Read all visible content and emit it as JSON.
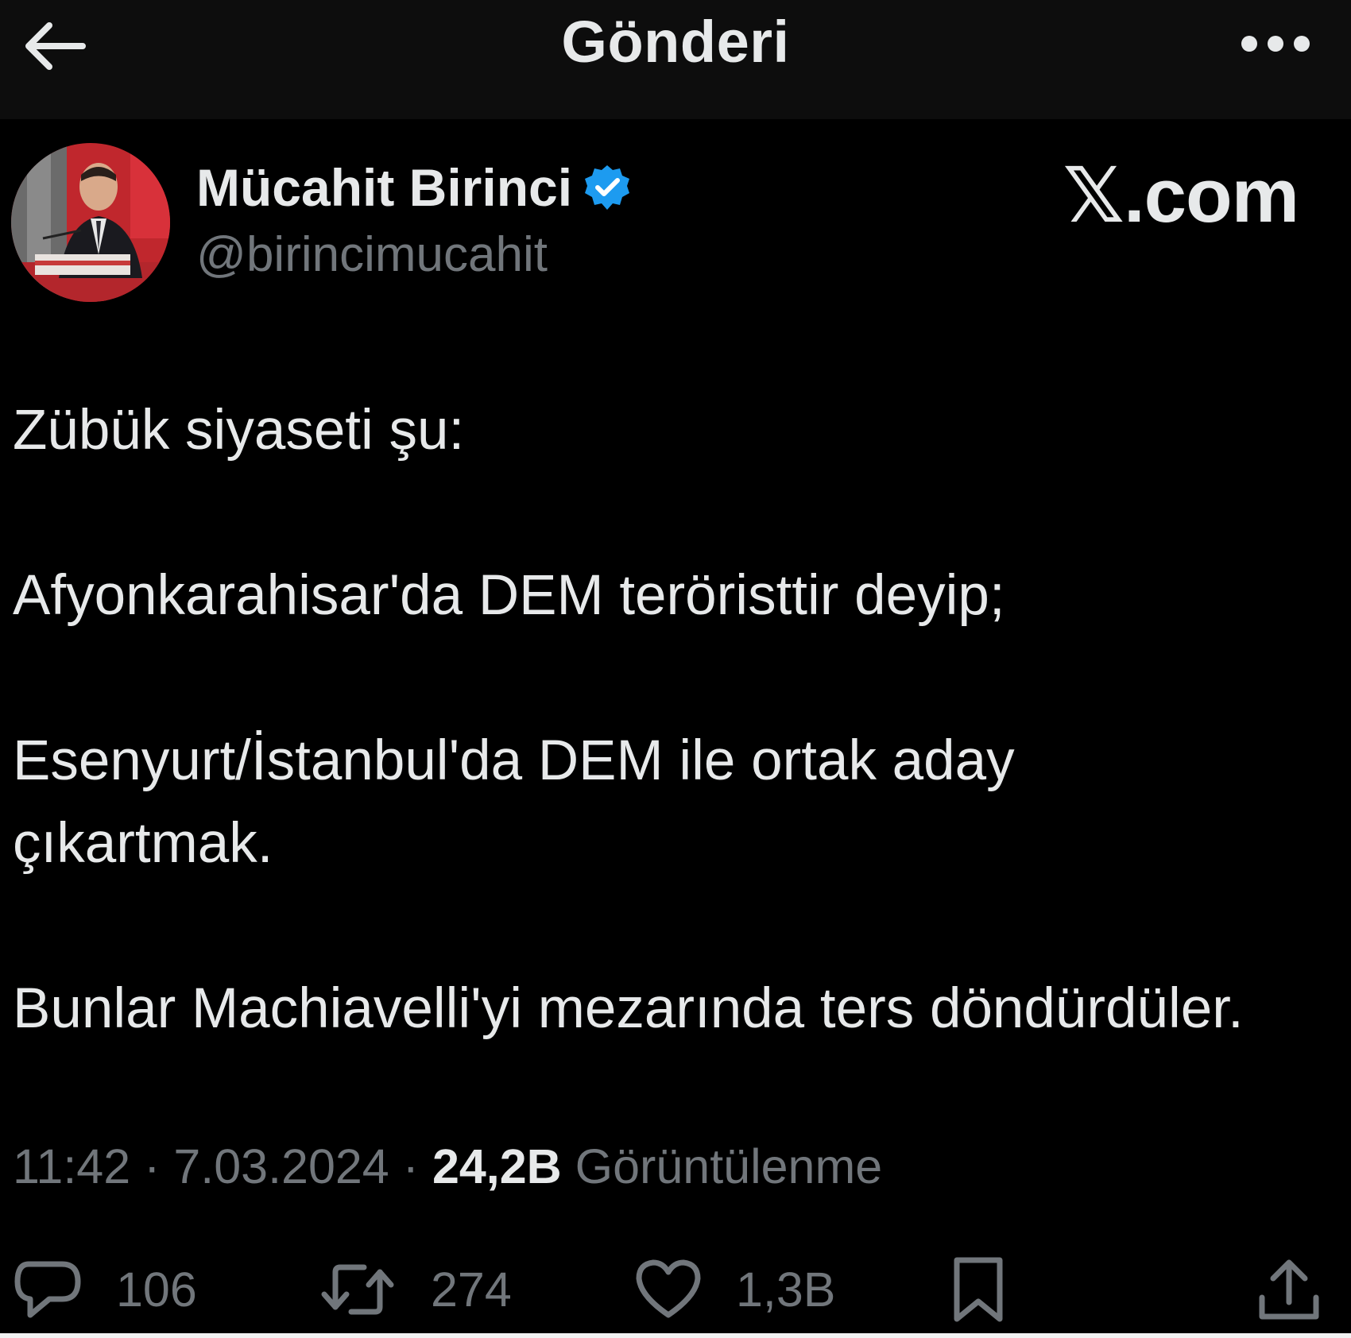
{
  "header": {
    "title": "Gönderi",
    "back_icon": "arrow-left-icon",
    "more_icon": "more-horizontal-icon"
  },
  "author": {
    "display_name": "Mücahit Birinci",
    "handle": "@birincimucahit",
    "verified": true,
    "verified_color": "#1d9bf0"
  },
  "watermark": "𝕏.com",
  "tweet": {
    "paragraphs": [
      "Zübük siyaseti şu:",
      "Afyonkarahisar'da DEM teröristtir deyip;",
      "Esenyurt/İstanbul'da DEM ile ortak aday çıkartmak.",
      "Bunlar Machiavelli'yi mezarında ters döndürdüler."
    ]
  },
  "meta": {
    "time": "11:42",
    "separator": " · ",
    "date": "7.03.2024",
    "views_count": "24,2B",
    "views_label": "Görüntülenme"
  },
  "actions": {
    "replies": "106",
    "reposts": "274",
    "likes": "1,3B"
  },
  "colors": {
    "background": "#000000",
    "header_bg": "#0d0d0d",
    "text_primary": "#e7e9ea",
    "text_secondary": "#71767b"
  }
}
